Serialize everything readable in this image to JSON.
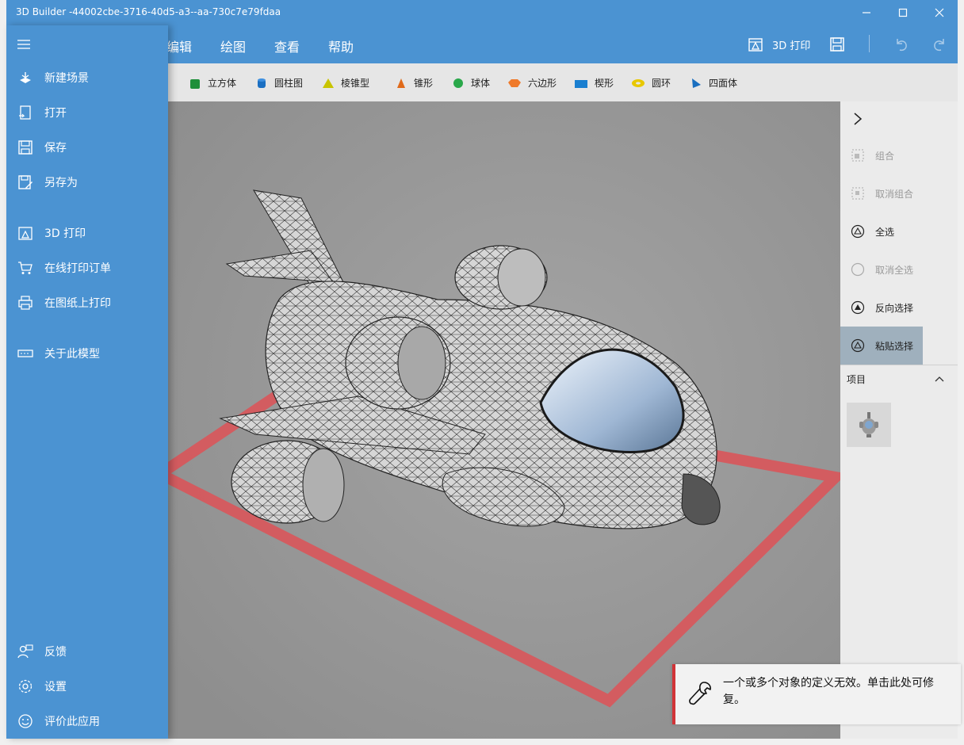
{
  "window": {
    "title": "3D Builder -44002cbe-3716-40d5-a3--aa-730c7e79fdaa",
    "minimize_icon": "minimize-icon",
    "maximize_icon": "maximize-icon",
    "close_icon": "close-icon",
    "accent": "#4b93d2"
  },
  "menubar": {
    "tabs": [
      {
        "label": "编辑"
      },
      {
        "label": "绘图"
      },
      {
        "label": "查看"
      },
      {
        "label": "帮助"
      }
    ],
    "print3d_label": "3D 打印",
    "save_icon": "save-icon",
    "undo_icon": "undo-icon",
    "redo_icon": "redo-icon"
  },
  "shapes": [
    {
      "label": "立方体",
      "color": "#1e8f3a",
      "icon": "cube-icon"
    },
    {
      "label": "圆柱图",
      "color": "#1b6fc2",
      "icon": "cylinder-icon"
    },
    {
      "label": "棱锥型",
      "color": "#c8c400",
      "icon": "pyramid-icon"
    },
    {
      "label": "锥形",
      "color": "#e06a1a",
      "icon": "cone-icon"
    },
    {
      "label": "球体",
      "color": "#2aa84a",
      "icon": "sphere-icon"
    },
    {
      "label": "六边形",
      "color": "#ef7a2a",
      "icon": "hexagon-icon"
    },
    {
      "label": "楔形",
      "color": "#1a7fd0",
      "icon": "wedge-icon"
    },
    {
      "label": "圆环",
      "color": "#e8c800",
      "icon": "torus-icon"
    },
    {
      "label": "四面体",
      "color": "#1a6fc0",
      "icon": "tetrahedron-icon"
    }
  ],
  "nav": {
    "menu_icon": "hamburger-icon",
    "items": [
      {
        "label": "新建场景",
        "icon": "new-scene-icon"
      },
      {
        "label": "打开",
        "icon": "open-icon"
      },
      {
        "label": "保存",
        "icon": "save-icon"
      },
      {
        "label": "另存为",
        "icon": "save-as-icon"
      },
      {
        "label": "3D 打印",
        "icon": "print-3d-icon"
      },
      {
        "label": "在线打印订单",
        "icon": "cart-icon"
      },
      {
        "label": "在图纸上打印",
        "icon": "printer-icon"
      },
      {
        "label": "关于此模型",
        "icon": "model-info-icon"
      }
    ],
    "bottom": [
      {
        "label": "反馈",
        "icon": "feedback-icon"
      },
      {
        "label": "设置",
        "icon": "settings-icon"
      },
      {
        "label": "评价此应用",
        "icon": "smiley-icon"
      }
    ]
  },
  "right_panel": {
    "expand_icon": "chevron-right-icon",
    "actions": [
      {
        "label": "组合",
        "state": "disabled",
        "icon": "group-icon"
      },
      {
        "label": "取消组合",
        "state": "disabled",
        "icon": "ungroup-icon"
      },
      {
        "label": "全选",
        "state": "enabled",
        "icon": "select-all-icon"
      },
      {
        "label": "取消全选",
        "state": "disabled",
        "icon": "deselect-all-icon"
      },
      {
        "label": "反向选择",
        "state": "enabled",
        "icon": "invert-selection-icon"
      },
      {
        "label": "粘贴选择",
        "state": "active",
        "icon": "paste-selection-icon"
      }
    ],
    "items_header": "项目",
    "items_collapse_icon": "chevron-up-icon",
    "thumbnail": "airplane-thumbnail"
  },
  "viewport": {
    "model": "cartoon-airplane-mesh",
    "platform_color": "#d9555a",
    "background": "#9a9a9a"
  },
  "toast": {
    "icon": "wrench-icon",
    "message": "一个或多个对象的定义无效。单击此处可修复。",
    "accent": "#d13438"
  }
}
